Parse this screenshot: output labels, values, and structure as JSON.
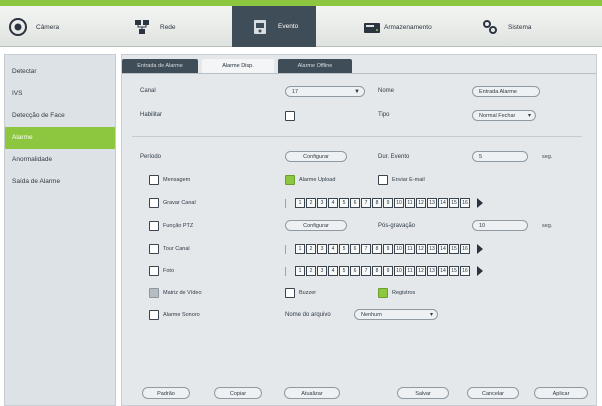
{
  "topnav": {
    "items": [
      {
        "label": "Câmera",
        "icon": "camera-icon"
      },
      {
        "label": "Rede",
        "icon": "network-icon"
      },
      {
        "label": "Evento",
        "icon": "event-icon"
      },
      {
        "label": "Armazenamento",
        "icon": "storage-icon"
      },
      {
        "label": "Sistema",
        "icon": "settings-icon"
      }
    ],
    "active_index": 2
  },
  "sidebar": {
    "items": [
      "Detectar",
      "IVS",
      "Detecção de Face",
      "Alarme",
      "Anormalidade",
      "Saída de Alarme"
    ],
    "active_index": 3
  },
  "tabs": [
    "Entrada de Alarme",
    "Alarme Disp.",
    "Alarme Offline"
  ],
  "active_tab": 1,
  "form": {
    "canal": {
      "label": "Canal",
      "value": "17"
    },
    "nome": {
      "label": "Nome",
      "value": "Entrada Alarme"
    },
    "habilitar": {
      "label": "Habilitar"
    },
    "tipo": {
      "label": "Tipo",
      "value": "Normal Fechar"
    },
    "periodo": {
      "label": "Período",
      "button": "Configurar"
    },
    "dur_evento": {
      "label": "Dur. Evento",
      "value": "5",
      "unit": "seg."
    },
    "mensagem": {
      "label": "Mensagem"
    },
    "alarme_upload": {
      "label": "Alarme Upload"
    },
    "enviar_email": {
      "label": "Enviar E-mail"
    },
    "gravar_canal": {
      "label": "Gravar Canal"
    },
    "funcao_ptz": {
      "label": "Função PTZ",
      "button": "Configurar"
    },
    "pos_gravacao": {
      "label": "Pós-gravação",
      "value": "10",
      "unit": "seg."
    },
    "tour_canal": {
      "label": "Tour Canal"
    },
    "foto": {
      "label": "Foto"
    },
    "matriz_video": {
      "label": "Matriz de Vídeo"
    },
    "buzzer": {
      "label": "Buzzer"
    },
    "registros": {
      "label": "Registros"
    },
    "alarme_sonoro": {
      "label": "Alarme Sonoro"
    },
    "nome_arquivo": {
      "label": "Nome do arquivo",
      "value": "Nenhum"
    }
  },
  "channels": [
    "1",
    "2",
    "3",
    "4",
    "5",
    "6",
    "7",
    "8",
    "9",
    "10",
    "11",
    "12",
    "13",
    "14",
    "15",
    "16"
  ],
  "buttons": {
    "padrao": "Padrão",
    "copiar": "Copiar",
    "atualizar": "Atualizar",
    "salvar": "Salvar",
    "cancelar": "Cancelar",
    "aplicar": "Aplicar"
  },
  "colors": {
    "accent": "#8dc63f",
    "dark_tab": "#3f4d58",
    "panel": "#e4e8eb"
  }
}
